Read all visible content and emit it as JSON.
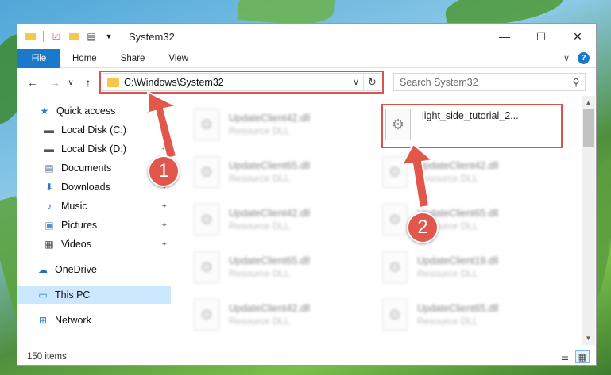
{
  "window": {
    "title": "System32",
    "controls": {
      "minimize": "—",
      "maximize": "☐",
      "close": "✕"
    }
  },
  "ribbon": {
    "tabs": [
      "File",
      "Home",
      "Share",
      "View"
    ],
    "expand": "∨",
    "help": "?"
  },
  "nav": {
    "back": "←",
    "forward": "→",
    "recent": "∨",
    "up": "↑",
    "address": "C:\\Windows\\System32",
    "address_dropdown": "∨",
    "refresh": "↻",
    "search_placeholder": "Search System32"
  },
  "sidebar": {
    "items": [
      {
        "label": "Quick access",
        "icon": "star-icon",
        "glyph": "★",
        "color": "#2b78c5",
        "pinned": false
      },
      {
        "label": "Local Disk (C:)",
        "icon": "drive-icon",
        "glyph": "▬",
        "color": "#555555",
        "pinned": true
      },
      {
        "label": "Local Disk (D:)",
        "icon": "drive-icon",
        "glyph": "▬",
        "color": "#555555",
        "pinned": true
      },
      {
        "label": "Documents",
        "icon": "documents-icon",
        "glyph": "▤",
        "color": "#6b7f99",
        "pinned": true
      },
      {
        "label": "Downloads",
        "icon": "downloads-icon",
        "glyph": "⬇",
        "color": "#2b78c5",
        "pinned": true
      },
      {
        "label": "Music",
        "icon": "music-icon",
        "glyph": "♪",
        "color": "#2b78c5",
        "pinned": true
      },
      {
        "label": "Pictures",
        "icon": "pictures-icon",
        "glyph": "▣",
        "color": "#5b8fc7",
        "pinned": true
      },
      {
        "label": "Videos",
        "icon": "videos-icon",
        "glyph": "▦",
        "color": "#444444",
        "pinned": true
      },
      {
        "label": "OneDrive",
        "icon": "onedrive-icon",
        "glyph": "☁",
        "color": "#1e6fc0",
        "pinned": false
      },
      {
        "label": "This PC",
        "icon": "computer-icon",
        "glyph": "▭",
        "color": "#2b78c5",
        "pinned": false,
        "selected": true
      },
      {
        "label": "Network",
        "icon": "network-icon",
        "glyph": "⊞",
        "color": "#2b78c5",
        "pinned": false
      }
    ],
    "pin_glyph": "📌"
  },
  "files": {
    "left_column": [
      {
        "name": "UpdateClient42.dll",
        "type": "Resource DLL"
      },
      {
        "name": "UpdateClient65.dll",
        "type": "Resource DLL"
      },
      {
        "name": "UpdateClient42.dll",
        "type": "Resource DLL"
      },
      {
        "name": "UpdateClient65.dll",
        "type": "Resource DLL"
      },
      {
        "name": "UpdateClient42.dll",
        "type": "Resource DLL"
      }
    ],
    "right_column": [
      {
        "name": "light_side_tutorial_2...",
        "type": "",
        "highlighted": true
      },
      {
        "name": "UpdateClient42.dll",
        "type": "Resource DLL"
      },
      {
        "name": "UpdateClient65.dll",
        "type": "Resource DLL"
      },
      {
        "name": "UpdateClient19.dll",
        "type": "Resource DLL"
      },
      {
        "name": "UpdateClient65.dll",
        "type": "Resource DLL"
      }
    ]
  },
  "status": {
    "item_count": "150 items"
  },
  "callouts": [
    {
      "number": "1"
    },
    {
      "number": "2"
    }
  ],
  "colors": {
    "accent": "#1979ca",
    "highlight_box": "#d9534f",
    "callout": "#e2574c",
    "selected_bg": "#cce8ff"
  }
}
